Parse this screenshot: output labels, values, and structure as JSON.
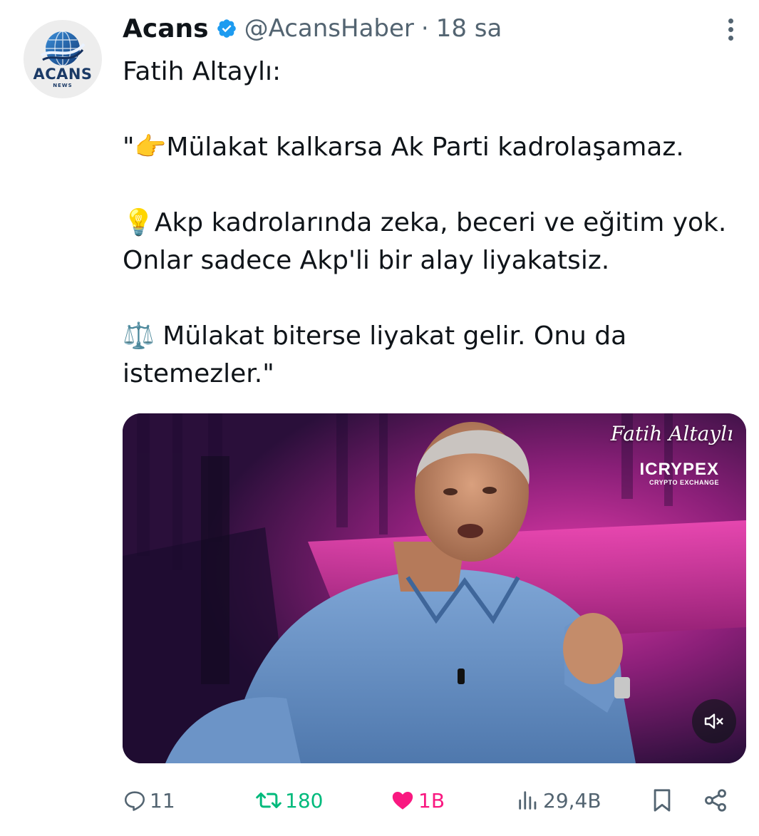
{
  "author": {
    "display_name": "Acans",
    "handle": "@AcansHaber",
    "separator": "·",
    "time": "18 sa",
    "verified": true,
    "avatar_brand": "ACANS",
    "avatar_brand_sub": "NEWS",
    "avatar_icon": "globe-logo-icon"
  },
  "tweet": {
    "lines": [
      "Fatih Altaylı:",
      "",
      "\"👉Mülakat kalkarsa Ak Parti kadrolaşamaz.",
      "",
      "💡Akp kadrolarında zeka, beceri ve eğitim yok. Onlar sadece Akp'li bir alay liyakatsiz.",
      "",
      "⚖️ Mülakat biterse liyakat gelir. Onu da istemezler.\""
    ]
  },
  "media": {
    "type": "video",
    "overlay_name": "Fatih Altaylı",
    "overlay_sponsor": "ICRYPEX",
    "overlay_sponsor_sub": "CRYPTO EXCHANGE",
    "mute_icon": "volume-muted-icon"
  },
  "actions": {
    "replies": "11",
    "retweets": "180",
    "likes": "1B",
    "views": "29,4B",
    "reply_icon": "reply-icon",
    "retweet_icon": "retweet-icon",
    "like_icon": "heart-icon",
    "views_icon": "analytics-icon",
    "bookmark_icon": "bookmark-icon",
    "share_icon": "share-icon"
  },
  "colors": {
    "text": "#0f1419",
    "secondary": "#536471",
    "verified": "#1d9bf0",
    "retweet": "#00ba7c",
    "like": "#f91880"
  }
}
